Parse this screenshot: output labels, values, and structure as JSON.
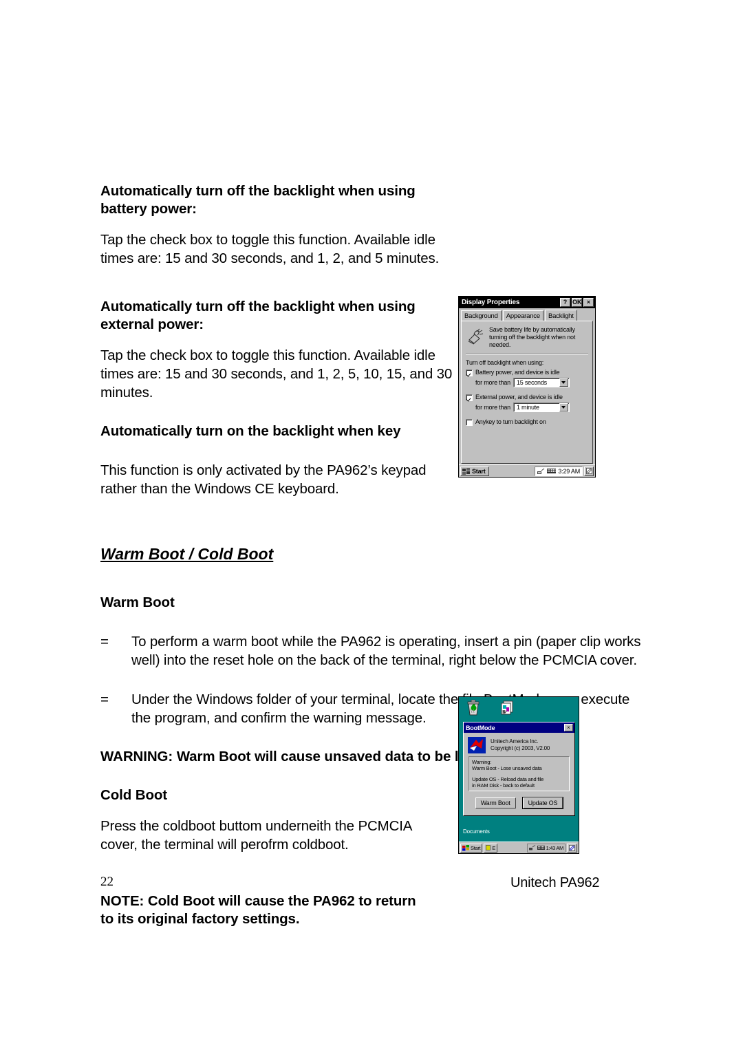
{
  "page": {
    "number": "22",
    "footer_right": "Unitech PA962"
  },
  "sections": {
    "battery_heading": "Automatically turn off the backlight when using battery power:",
    "battery_body": "Tap the check box to toggle this function.  Available idle times are: 15 and 30 seconds, and 1, 2, and 5 minutes.",
    "external_heading": "Automatically turn off the backlight when using external power:",
    "external_body": "Tap the check box to toggle this function.  Available idle times are:  15 and 30 seconds, and 1, 2, 5, 10, 15, and 30 minutes.",
    "key_heading": "Automatically turn on the backlight when key",
    "key_body": "This function is only activated by the PA962’s keypad rather than the Windows CE keyboard.",
    "warm_cold_heading": "Warm Boot / Cold Boot",
    "warm_boot_heading": "Warm Boot",
    "bullet_marker": "=",
    "warm_bullet_1": "To perform a warm boot while the PA962 is operating, insert a pin (paper clip works well) into the reset hole on the back of the terminal, right below the PCMCIA cover.",
    "warm_bullet_2": "Under the Windows folder of your terminal, locate the file BootMode.exe, execute the program, and confirm the warning message.",
    "warning_text": "WARNING:  Warm Boot will cause unsaved data to be lost.",
    "cold_boot_heading": "Cold Boot",
    "cold_boot_body": "Press the coldboot buttom underneith the PCMCIA cover, the terminal will perofrm coldboot.",
    "note_text": "NOTE:  Cold Boot will cause the PA962 to return to its original factory settings."
  },
  "display_properties": {
    "title": "Display Properties",
    "help_button": "?",
    "ok_button": "OK",
    "close_button": "×",
    "tabs": [
      {
        "label": "Background",
        "active": false
      },
      {
        "label": "Appearance",
        "active": false
      },
      {
        "label": "Backlight",
        "active": true
      }
    ],
    "info_text": "Save battery life by automatically turning off the backlight when not needed.",
    "group_label": "Turn off backlight when using:",
    "battery_option": {
      "label": "Battery power, and device is idle",
      "sub_label": "for more than",
      "checked": true,
      "value": "15 seconds"
    },
    "external_option": {
      "label": "External power, and device is idle",
      "sub_label": "for more than",
      "checked": true,
      "value": "1 minute"
    },
    "anykey_option": {
      "label": "Anykey to turn backlight on",
      "checked": false
    },
    "taskbar": {
      "start_label": "Start",
      "clock": "3:29 AM"
    },
    "colors": {
      "window_face": "#c0c0c0",
      "titlebar": "#000000",
      "titlebar_text": "#ffffff"
    }
  },
  "bootmode": {
    "desktop_icons": [
      {
        "name": "recycle-bin-icon"
      },
      {
        "name": "my-documents-icon"
      }
    ],
    "title": "BootMode",
    "close_button": "×",
    "vendor_line_1": "Unitech America Inc.",
    "vendor_line_2": "Copyright (c) 2003, V2.00",
    "message_line_1": "Warning:",
    "message_line_2": "Warm Boot - Lose unsaved data",
    "message_line_3": "Update OS - Reload data and file",
    "message_line_4": "in RAM Disk - back to default",
    "buttons": [
      {
        "label": "Warm Boot",
        "default": false
      },
      {
        "label": "Update OS",
        "default": true
      }
    ],
    "desktop_label": "Documents",
    "taskbar": {
      "start_label": "Start",
      "task_label": "E",
      "clock": "1:43 AM"
    },
    "colors": {
      "desktop": "#008080",
      "titlebar": "#000080",
      "window_face": "#c0c0c0"
    }
  }
}
